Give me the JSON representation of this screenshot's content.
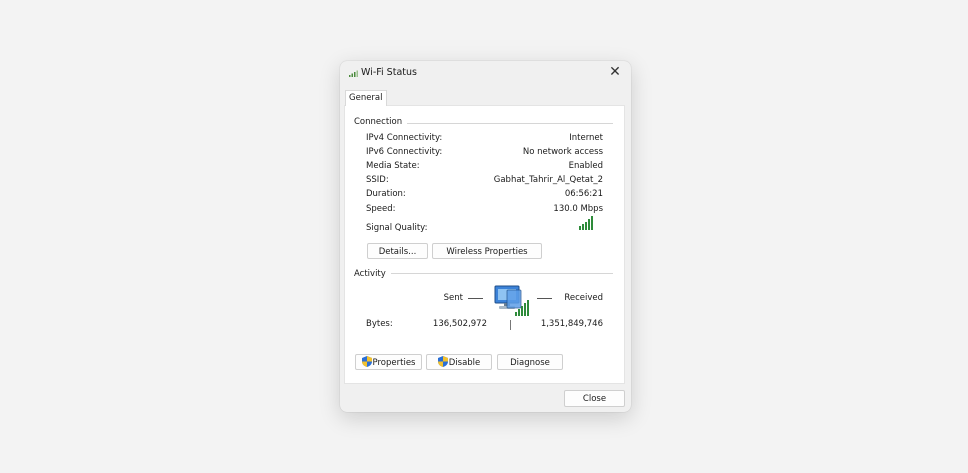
{
  "window": {
    "title": "Wi-Fi Status",
    "close_glyph": "✕"
  },
  "tabs": [
    "General"
  ],
  "connection": {
    "heading": "Connection",
    "rows": [
      {
        "label": "IPv4 Connectivity:",
        "value": "Internet"
      },
      {
        "label": "IPv6 Connectivity:",
        "value": "No network access"
      },
      {
        "label": "Media State:",
        "value": "Enabled"
      },
      {
        "label": "SSID:",
        "value": "Gabhat_Tahrir_Al_Qetat_2"
      },
      {
        "label": "Duration:",
        "value": "06:56:21"
      },
      {
        "label": "Speed:",
        "value": "130.0 Mbps"
      }
    ],
    "signal_label": "Signal Quality:",
    "signal_icon": "signal-bars-icon",
    "signal_bars": 5,
    "details_button": "Details...",
    "wireless_properties_button": "Wireless Properties"
  },
  "activity": {
    "heading": "Activity",
    "sent_label": "Sent",
    "received_label": "Received",
    "bytes_label": "Bytes:",
    "bytes_sent": "136,502,972",
    "bytes_received": "1,351,849,746",
    "network_icon": "network-computer-icon"
  },
  "buttons": {
    "properties": "Properties",
    "disable": "Disable",
    "diagnose": "Diagnose",
    "close": "Close"
  },
  "colors": {
    "signal_green": "#2e8b3a",
    "shield_blue": "#2a6fd6",
    "shield_yellow": "#f2c12e"
  }
}
